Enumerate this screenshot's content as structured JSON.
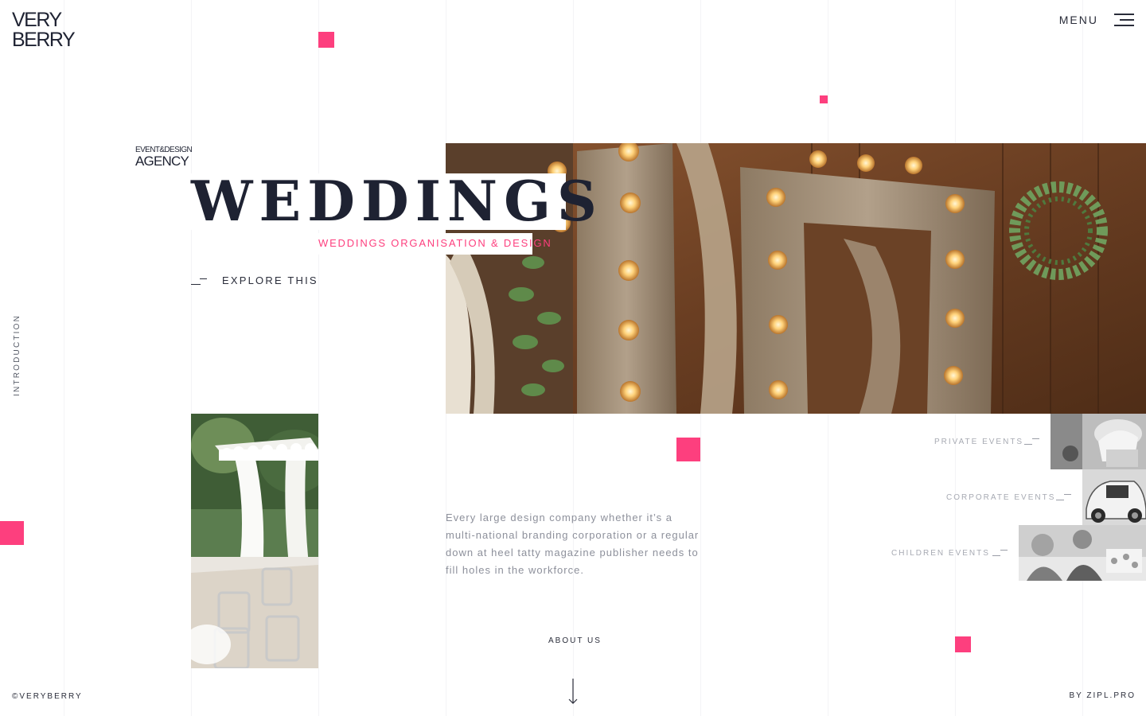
{
  "brand": {
    "logo_line1": "VERY",
    "logo_line2": "BERRY"
  },
  "header": {
    "menu_label": "MENU"
  },
  "agency": {
    "line1": "EVENT&DESIGN",
    "line2": "AGENCY"
  },
  "hero": {
    "title": "WEDDINGS",
    "subtitle": "WEDDINGS ORGANISATION & DESIGN",
    "explore_label": "EXPLORE THIS"
  },
  "side": {
    "section_label": "INTRODUCTION"
  },
  "description": "Every large design company whether it’s a multi-national branding corporation or a regular down at heel tatty magazine publisher needs to fill holes in the workforce.",
  "about_label": "ABOUT US",
  "events": [
    {
      "label": "PRIVATE EVENTS"
    },
    {
      "label": "CORPORATE EVENTS"
    },
    {
      "label": "CHILDREN EVENTS"
    }
  ],
  "footer": {
    "copyright": "©VERYBERRY",
    "credit": "BY ZIPL.PRO"
  },
  "colors": {
    "accent": "#fd3f7e",
    "dark": "#1e2232",
    "muted": "#8d909b"
  },
  "icons": [
    "hamburger-menu-icon",
    "dash-icon",
    "down-arrow-icon"
  ]
}
